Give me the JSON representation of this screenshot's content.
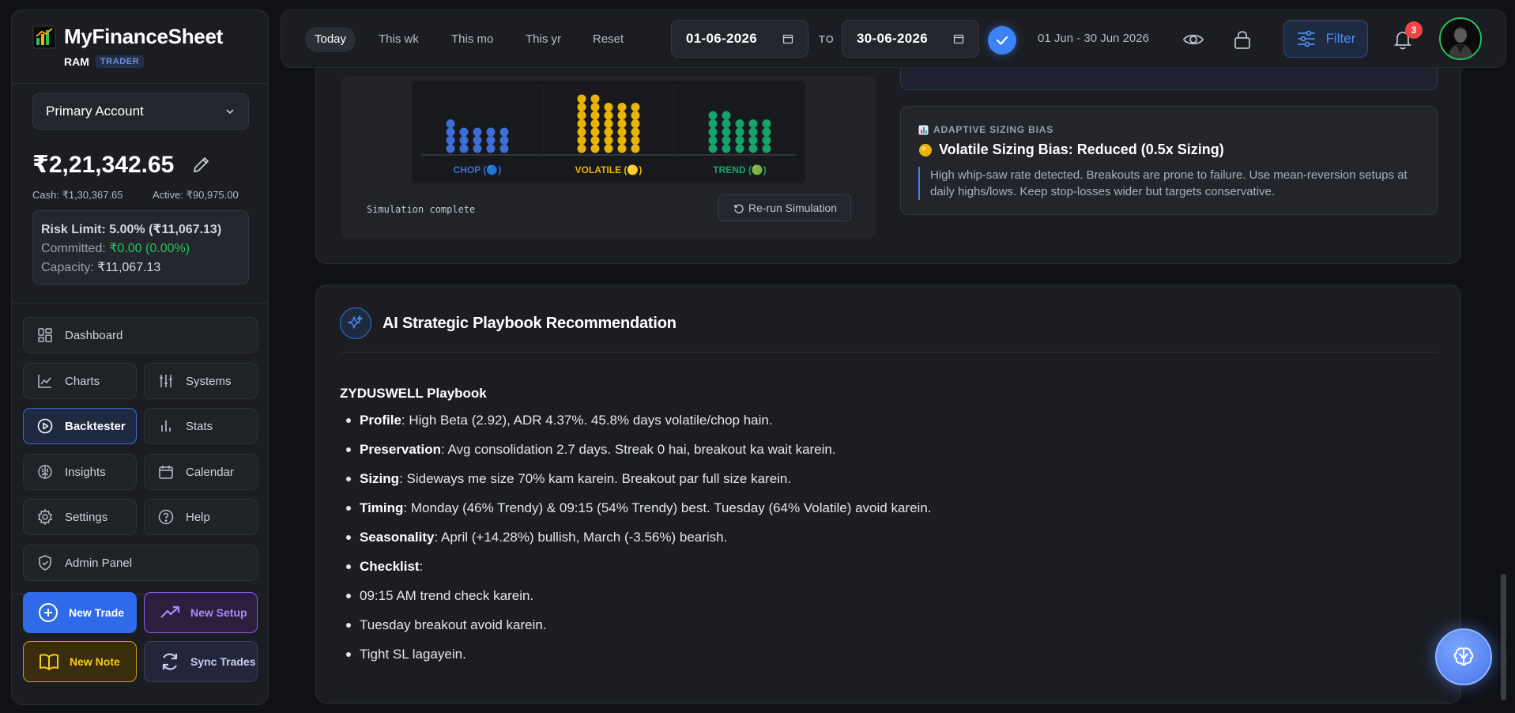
{
  "brand": {
    "title": "MyFinanceSheet",
    "user": "RAM",
    "role": "TRADER"
  },
  "account": {
    "selected": "Primary Account",
    "balance": "₹2,21,342.65",
    "cash": "Cash: ₹1,30,367.65",
    "active": "Active: ₹90,975.00"
  },
  "risk": {
    "limit_label": "Risk Limit:",
    "limit_value": "5.00% (₹11,067.13)",
    "committed_label": "Committed:",
    "committed_value": "₹0.00 (0.00%)",
    "capacity_label": "Capacity:",
    "capacity_value": "₹11,067.13"
  },
  "nav": {
    "dashboard": "Dashboard",
    "charts": "Charts",
    "systems": "Systems",
    "backtester": "Backtester",
    "stats": "Stats",
    "insights": "Insights",
    "calendar": "Calendar",
    "settings": "Settings",
    "help": "Help",
    "admin": "Admin Panel"
  },
  "actions": {
    "new_trade": "New Trade",
    "new_setup": "New Setup",
    "new_note": "New Note",
    "sync_trades": "Sync Trades"
  },
  "topbar": {
    "ranges": [
      "Today",
      "This wk",
      "This mo",
      "This yr",
      "Reset"
    ],
    "active_range": "Today",
    "date_from": "01-06-2026",
    "to_label": "TO",
    "date_to": "30-06-2026",
    "range_text": "01 Jun - 30 Jun 2026",
    "filter_label": "Filter",
    "notification_count": "3"
  },
  "simulation": {
    "categories": [
      {
        "label": "CHOP (🔵)",
        "color": "#3b6fd6",
        "columns": [
          4,
          3,
          3,
          3,
          3
        ]
      },
      {
        "label": "VOLATILE (🟡)",
        "color": "#eab308",
        "columns": [
          7,
          7,
          6,
          6,
          6
        ]
      },
      {
        "label": "TREND (🟢)",
        "color": "#16a36a",
        "columns": [
          5,
          5,
          4,
          4,
          4
        ]
      }
    ],
    "status": "Simulation complete",
    "rerun_label": "Re-run Simulation"
  },
  "insight": {
    "tag": "ADAPTIVE SIZING BIAS",
    "title": "Volatile Sizing Bias: Reduced (0.5x Sizing)",
    "body": "High whip-saw rate detected. Breakouts are prone to failure. Use mean-reversion setups at daily highs/lows. Keep stop-losses wider but targets conservative."
  },
  "ai": {
    "title": "AI Strategic Playbook Recommendation",
    "playbook_title": "ZYDUSWELL Playbook",
    "items": [
      {
        "label": "Profile",
        "text": ": High Beta (2.92), ADR 4.37%. 45.8% days volatile/chop hain."
      },
      {
        "label": "Preservation",
        "text": ": Avg consolidation 2.7 days. Streak 0 hai, breakout ka wait karein."
      },
      {
        "label": "Sizing",
        "text": ": Sideways me size 70% kam karein. Breakout par full size karein."
      },
      {
        "label": "Timing",
        "text": ": Monday (46% Trendy) & 09:15 (54% Trendy) best. Tuesday (64% Volatile) avoid karein."
      },
      {
        "label": "Seasonality",
        "text": ": April (+14.28%) bullish, March (-3.56%) bearish."
      },
      {
        "label": "Checklist",
        "text": ":"
      },
      {
        "label": "",
        "text": "09:15 AM trend check karein."
      },
      {
        "label": "",
        "text": "Tuesday breakout avoid karein."
      },
      {
        "label": "",
        "text": "Tight SL lagayein."
      }
    ]
  }
}
